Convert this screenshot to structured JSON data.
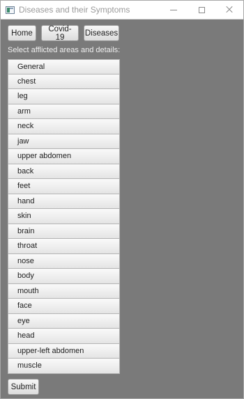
{
  "window": {
    "title": "Diseases and their Symptoms",
    "icon": "app-icon"
  },
  "nav": {
    "home_label": "Home",
    "covid_label": "Covid-19",
    "diseases_label": "Diseases"
  },
  "prompt": "Select afflicted areas and details:",
  "areas": [
    "General",
    "chest",
    "leg",
    "arm",
    "neck",
    "jaw",
    "upper abdomen",
    "back",
    "feet",
    "hand",
    "skin",
    "brain",
    "throat",
    "nose",
    "body",
    "mouth",
    "face",
    "eye",
    "head",
    "upper-left abdomen",
    "muscle"
  ],
  "submit_label": "Submit"
}
